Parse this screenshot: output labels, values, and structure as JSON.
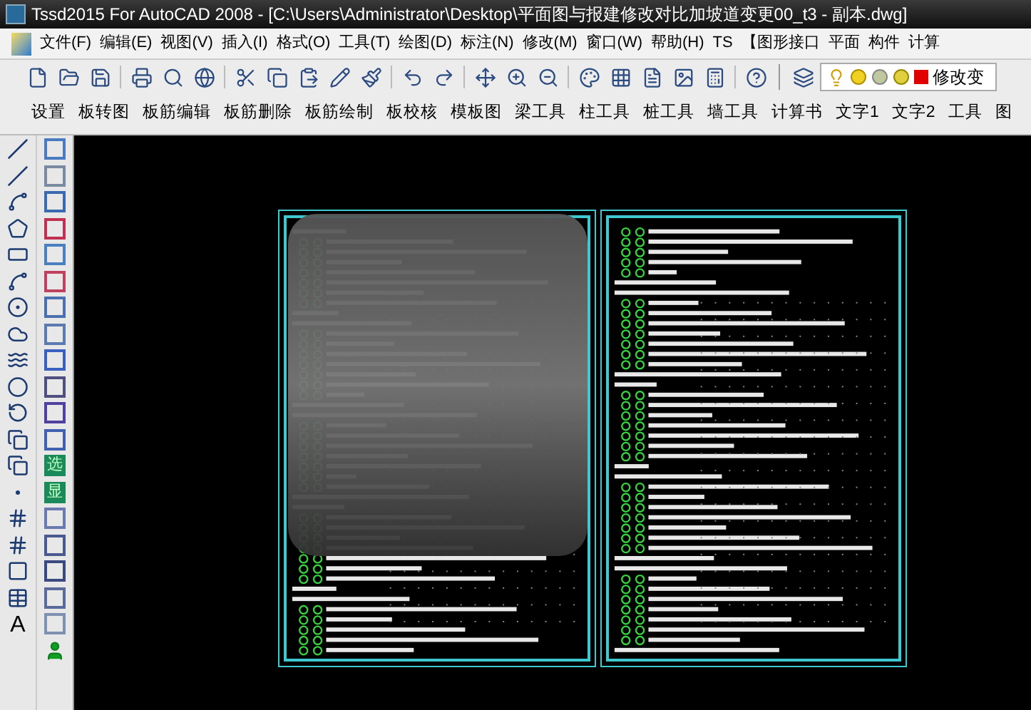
{
  "window": {
    "title": "Tssd2015 For AutoCAD 2008 - [C:\\Users\\Administrator\\Desktop\\平面图与报建修改对比加坡道变更00_t3 - 副本.dwg]"
  },
  "menu": [
    "文件(F)",
    "编辑(E)",
    "视图(V)",
    "插入(I)",
    "格式(O)",
    "工具(T)",
    "绘图(D)",
    "标注(N)",
    "修改(M)",
    "窗口(W)",
    "帮助(H)",
    "TS",
    "【图形接口",
    "平面",
    "构件",
    "计算"
  ],
  "toolbar": {
    "layer_name": "修改变"
  },
  "ribbon": [
    "设置",
    "板转图",
    "板筋编辑",
    "板筋删除",
    "板筋绘制",
    "板校核",
    "模板图",
    "梁工具",
    "柱工具",
    "桩工具",
    "墙工具",
    "计算书",
    "文字1",
    "文字2",
    "工具",
    "图"
  ],
  "draw_toolbar": {
    "text_tool": "A"
  },
  "tssd_toolbar": {
    "glyphs": [
      "选",
      "显"
    ]
  }
}
